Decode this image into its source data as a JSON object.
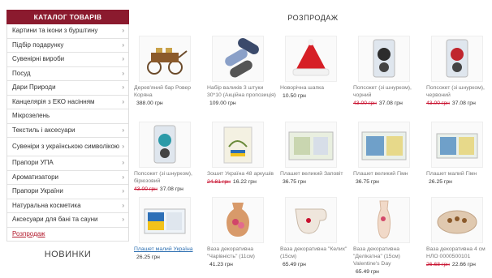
{
  "sidebar": {
    "title": "КАТАЛОГ ТОВАРІВ",
    "items": [
      {
        "label": "Картини та ікони з бурштину",
        "chev": "›"
      },
      {
        "label": "Підбір подарунку",
        "chev": "›"
      },
      {
        "label": "Сувенірні вироби",
        "chev": "›"
      },
      {
        "label": "Посуд",
        "chev": "›"
      },
      {
        "label": "Дари Природи",
        "chev": "›"
      },
      {
        "label": "Канцелярія з ЕКО насінням",
        "chev": "›"
      },
      {
        "label": "Мікрозелень",
        "chev": ""
      },
      {
        "label": "Текстиль і аксесуари",
        "chev": "›"
      },
      {
        "label": "Сувеніри з українською символікою",
        "chev": "›"
      },
      {
        "label": "Прапори УПА",
        "chev": "›"
      },
      {
        "label": "Ароматизатори",
        "chev": "›"
      },
      {
        "label": "Прапори України",
        "chev": "›"
      },
      {
        "label": "Натуральна косметика",
        "chev": "›"
      },
      {
        "label": "Аксесуари для бані та сауни",
        "chev": "›"
      },
      {
        "label": "Розпродаж",
        "chev": ""
      }
    ],
    "novinki": "НОВИНКИ"
  },
  "main": {
    "title": "РОЗПРОДАЖ",
    "products": [
      {
        "name": "Дерев'яний бар Ровер Коряна",
        "old": "",
        "price": "388.00 грн"
      },
      {
        "name": "Набір валиків 3 штуки 30*10 (Акційна пропозиція)",
        "old": "",
        "price": "109.00 грн"
      },
      {
        "name": "Новорічна шапка",
        "old": "",
        "price": "10.50 грн"
      },
      {
        "name": "Попсокет (зі шнурком), чорний",
        "old": "43.00 грн",
        "price": "37.08 грн"
      },
      {
        "name": "Попсокет (зі шнурком), червоний",
        "old": "43.00 грн",
        "price": "37.08 грн"
      },
      {
        "name": "Попсокет (зі шнурком), бірюзовий",
        "old": "43.00 грн",
        "price": "37.08 грн"
      },
      {
        "name": "Зошит Україна 48 аркушів",
        "old": "24.81 грн",
        "price": "16.22 грн"
      },
      {
        "name": "Плашет великий Заповіт",
        "old": "",
        "price": "36.75 грн"
      },
      {
        "name": "Плашет великий Гімн",
        "old": "",
        "price": "36.75 грн"
      },
      {
        "name": "Плашет малий Гімн",
        "old": "",
        "price": "26.25 грн"
      },
      {
        "name": "Плашет малий Україна",
        "old": "",
        "price": "26.25 грн"
      },
      {
        "name": "Ваза декоративна \"Чарівність\" (11см)",
        "old": "",
        "price": "41.23 грн"
      },
      {
        "name": "Ваза декоративна \"Келих\" (15см)",
        "old": "",
        "price": "65.49 грн"
      },
      {
        "name": "Ваза декоративна \"Делікатна\" (15см) Valentine's Day",
        "old": "",
        "price": "65.49 грн"
      },
      {
        "name": "Ваза декоративна 4 см НЛО 0000500101",
        "old": "26.68 грн",
        "price": "22.66 грн"
      }
    ]
  }
}
